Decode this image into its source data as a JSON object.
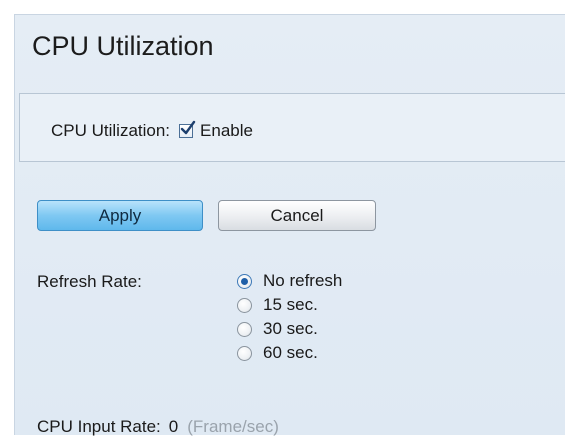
{
  "page": {
    "title": "CPU Utilization"
  },
  "enable_panel": {
    "label": "CPU Utilization:",
    "checkbox_label": "Enable",
    "checked": true
  },
  "buttons": {
    "apply_label": "Apply",
    "cancel_label": "Cancel"
  },
  "refresh": {
    "label": "Refresh Rate:",
    "options": [
      {
        "label": "No refresh",
        "selected": true
      },
      {
        "label": "15 sec.",
        "selected": false
      },
      {
        "label": "30 sec.",
        "selected": false
      },
      {
        "label": "60 sec.",
        "selected": false
      }
    ]
  },
  "input_rate": {
    "label": "CPU Input Rate:",
    "value": "0",
    "unit": "(Frame/sec)"
  },
  "colors": {
    "background": "#dfe9f3",
    "apply_button": "#7fc8f2",
    "radio_selected": "#1f5fa8"
  },
  "icons": {
    "checkbox": "checkmark-icon"
  }
}
